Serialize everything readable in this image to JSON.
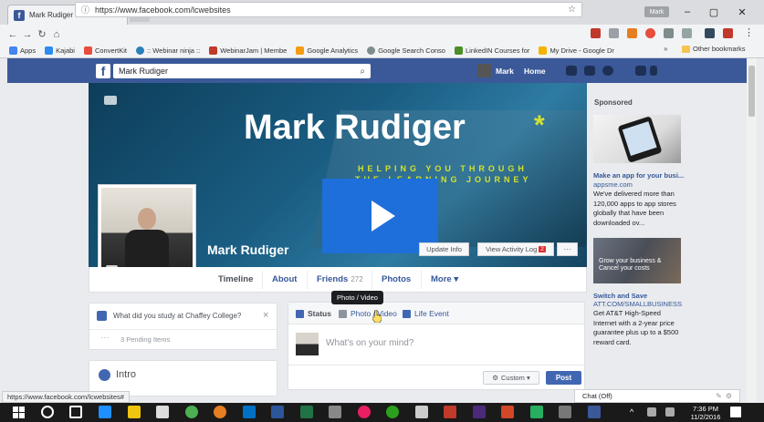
{
  "browser": {
    "tab_title": "Mark Rudiger",
    "tab_close": "×",
    "user_badge": "Mark",
    "url": "https://www.facebook.com/lcwebsites",
    "status_url": "https://www.facebook.com/lcwebsites#"
  },
  "bookmarks": [
    "Apps",
    "Kajabi",
    "ConvertKit",
    ":: Webinar ninja ::",
    "WebinarJam | Membe",
    "Google Analytics",
    "Google Search Conso",
    "LinkedIN Courses for",
    "My Drive - Google Dr"
  ],
  "bookmarks_more": "»",
  "bookmarks_other": "Other bookmarks",
  "fb": {
    "search_value": "Mark Rudiger",
    "profile_short": "Mark",
    "home": "Home"
  },
  "cover": {
    "headline": "Mark Rudiger",
    "star": "*",
    "tagline_1": "HELPING YOU THROUGH",
    "tagline_2": "THE LEARNING JOURNEY",
    "profile_name": "Mark Rudiger",
    "update_info": "Update Info",
    "activity_log": "View Activity Log",
    "activity_badge": "2",
    "more": "···"
  },
  "profile_nav": [
    {
      "label": "Timeline",
      "count": ""
    },
    {
      "label": "About",
      "count": ""
    },
    {
      "label": "Friends",
      "count": "272"
    },
    {
      "label": "Photos",
      "count": ""
    },
    {
      "label": "More ▾",
      "count": ""
    }
  ],
  "question_card": {
    "text": "What did you study at Chaffey College?",
    "close": "×",
    "dots": "···",
    "pending": "3 Pending Items"
  },
  "intro": {
    "title": "Intro"
  },
  "composer": {
    "tabs": [
      "Status",
      "Photo / Video",
      "Life Event"
    ],
    "placeholder": "What's on your mind?",
    "custom": "Custom ▾",
    "post": "Post",
    "tooltip": "Photo / Video"
  },
  "ads": {
    "sponsored": "Sponsored",
    "ad1_title": "Make an app for your busi...",
    "ad1_domain": "appsme.com",
    "ad1_body": "We've delivered more than 120,000 apps to app stores globally that have been downloaded ov...",
    "ad2_caption": "Grow your business & Cancel your costs",
    "ad2_title": "Switch and Save",
    "ad2_domain": "ATT.COM/SMALLBUSINESS",
    "ad2_body": "Get AT&T High-Speed Internet with a 2-year price guarantee plus up to a $500 reward card."
  },
  "chat": {
    "label": "Chat (Off)"
  },
  "taskbar": {
    "time": "7:36 PM",
    "date": "11/2/2016"
  },
  "colors": {
    "fb_blue": "#3b5998",
    "play_blue": "#1e6fd9",
    "accent_yellow": "#d4e22b",
    "post_blue": "#4267b2"
  }
}
